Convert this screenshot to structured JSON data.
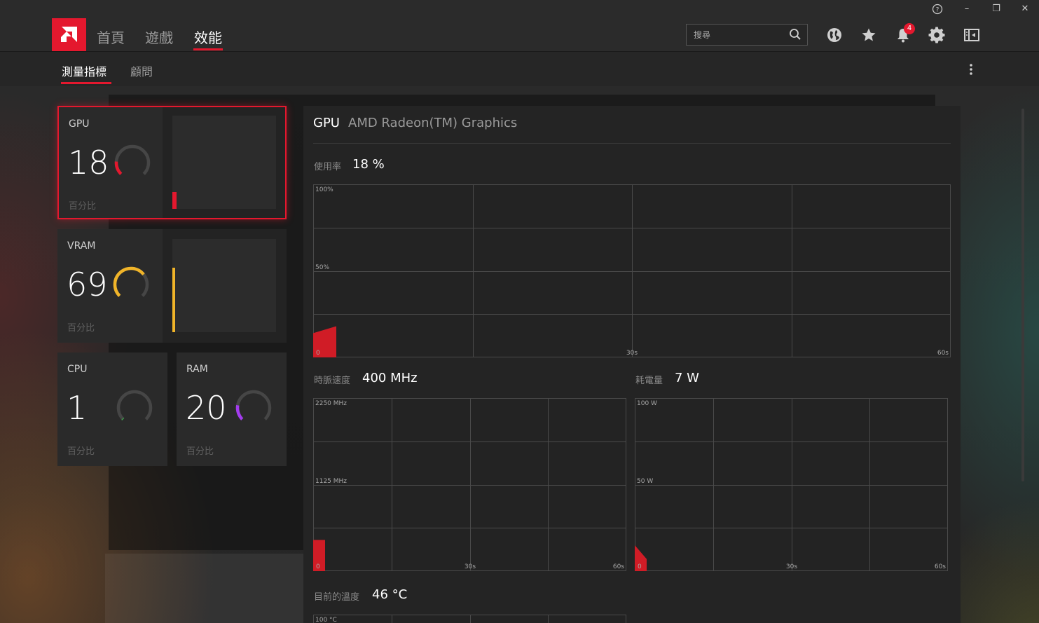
{
  "window": {
    "help_glyph": "?",
    "minimize_glyph": "–",
    "restore_glyph": "❐",
    "close_glyph": "✕"
  },
  "nav": {
    "tabs": [
      {
        "label": "首頁",
        "active": false
      },
      {
        "label": "遊戲",
        "active": false
      },
      {
        "label": "效能",
        "active": true
      }
    ],
    "search_placeholder": "搜尋",
    "notification_count": "4",
    "accent": "#e4182e"
  },
  "subnav": {
    "tabs": [
      {
        "label": "測量指標",
        "active": true
      },
      {
        "label": "顧問",
        "active": false
      }
    ]
  },
  "cards": [
    {
      "label": "GPU",
      "value": "18",
      "unit": "百分比",
      "percent": 18,
      "color": "#e4182e",
      "history_level": 0.18
    },
    {
      "label": "VRAM",
      "value": "69",
      "unit": "百分比",
      "percent": 69,
      "color": "#f0b429",
      "history_level": 0.69
    },
    {
      "label": "CPU",
      "value": "1",
      "unit": "百分比",
      "percent": 1,
      "color": "#39b54a"
    },
    {
      "label": "RAM",
      "value": "20",
      "unit": "百分比",
      "percent": 20,
      "color": "#a43cf0"
    }
  ],
  "detail": {
    "title": "GPU",
    "subtitle": "AMD Radeon(TM) Graphics",
    "usage": {
      "label": "使用率",
      "value": "18 %",
      "y_max": "100%",
      "y_mid": "50%",
      "x_start": "0",
      "x_mid": "30s",
      "x_end": "60s",
      "current_fraction": 0.18,
      "start_fraction": 0.14
    },
    "clock": {
      "label": "時脈速度",
      "value": "400 MHz",
      "y_max": "2250 MHz",
      "y_mid": "1125 MHz",
      "x_start": "0",
      "x_mid": "30s",
      "x_end": "60s",
      "current_fraction": 0.18,
      "start_fraction": 0.18
    },
    "power": {
      "label": "耗電量",
      "value": "7 W",
      "y_max": "100 W",
      "y_mid": "50 W",
      "x_start": "0",
      "x_mid": "30s",
      "x_end": "60s",
      "current_fraction": 0.07,
      "start_fraction": 0.15
    },
    "temperature": {
      "label": "目前的溫度",
      "value": "46 °C",
      "y_max": "100 °C"
    }
  }
}
